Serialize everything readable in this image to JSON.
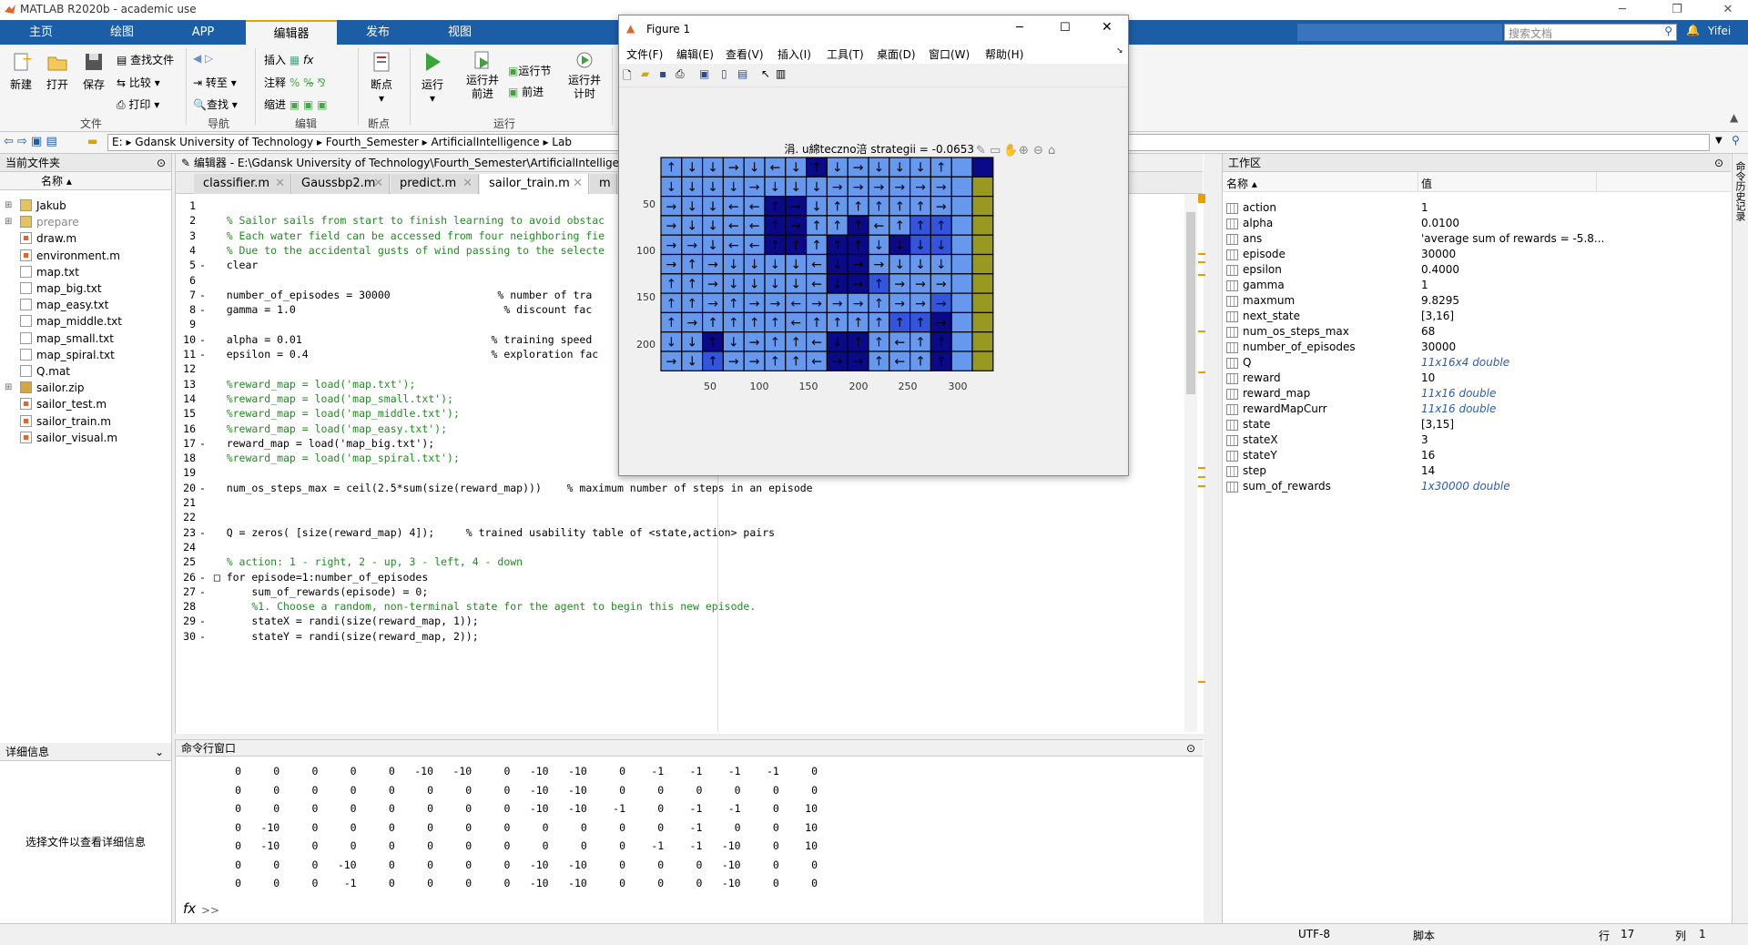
{
  "app": {
    "title": "MATLAB R2020b - academic use"
  },
  "tabs": [
    "主页",
    "绘图",
    "APP",
    "编辑器",
    "发布",
    "视图"
  ],
  "search": {
    "placeholder": "搜索文档"
  },
  "user": "Yifei",
  "ribbon": {
    "file": {
      "new": "新建",
      "open": "打开",
      "save": "保存",
      "find_files": "查找文件",
      "compare": "比较",
      "print": "打印",
      "group": "文件"
    },
    "nav": {
      "goto": "转至",
      "find": "查找",
      "group": "导航"
    },
    "edit": {
      "insert": "插入",
      "comment": "注释",
      "indent": "缩进",
      "fx": "fx",
      "group": "编辑"
    },
    "bp": {
      "breakpoints": "断点",
      "group": "断点"
    },
    "run": {
      "run": "运行",
      "run_advance": "运行并\n前进",
      "run_section": "运行节",
      "advance": "前进",
      "run_time": "运行并\n计时",
      "group": "运行"
    }
  },
  "address": [
    "E:",
    "Gdansk University of Technology",
    "Fourth_Semester",
    "ArtificialIntelligence",
    "Lab"
  ],
  "current_folder": {
    "title": "当前文件夹",
    "col": "名称 ▴",
    "files": [
      {
        "name": "Jakub",
        "type": "folder",
        "exp": true
      },
      {
        "name": "prepare",
        "type": "folder",
        "exp": true,
        "gray": true
      },
      {
        "name": "draw.m",
        "type": "m"
      },
      {
        "name": "environment.m",
        "type": "m"
      },
      {
        "name": "map.txt",
        "type": "txt"
      },
      {
        "name": "map_big.txt",
        "type": "txt"
      },
      {
        "name": "map_easy.txt",
        "type": "txt"
      },
      {
        "name": "map_middle.txt",
        "type": "txt"
      },
      {
        "name": "map_small.txt",
        "type": "txt"
      },
      {
        "name": "map_spiral.txt",
        "type": "txt"
      },
      {
        "name": "Q.mat",
        "type": "mat"
      },
      {
        "name": "sailor.zip",
        "type": "zip",
        "exp": true
      },
      {
        "name": "sailor_test.m",
        "type": "m"
      },
      {
        "name": "sailor_train.m",
        "type": "m"
      },
      {
        "name": "sailor_visual.m",
        "type": "m"
      }
    ]
  },
  "details": {
    "title": "详细信息",
    "msg": "选择文件以查看详细信息"
  },
  "editor": {
    "title": "编辑器 - E:\\Gdansk University of Technology\\Fourth_Semester\\ArtificialIntelligen",
    "tabs": [
      "classifier.m",
      "Gaussbp2.m",
      "predict.m",
      "sailor_train.m",
      "m"
    ],
    "lines": [
      {
        "n": "1",
        "t": ""
      },
      {
        "n": "2",
        "t": "    % Sailor sails from start to finish learning to avoid obstac",
        "c": 1
      },
      {
        "n": "3",
        "t": "    % Each water field can be accessed from four neighboring fie",
        "c": 1
      },
      {
        "n": "4",
        "t": "    % Due to the accidental gusts of wind passing to the selecte",
        "c": 1
      },
      {
        "n": "5",
        "t": "    clear",
        "d": 1
      },
      {
        "n": "6",
        "t": ""
      },
      {
        "n": "7",
        "t": "    number_of_episodes = 30000                 % number of tra",
        "d": 1
      },
      {
        "n": "8",
        "t": "    gamma = 1.0                                 % discount fac",
        "d": 1
      },
      {
        "n": "9",
        "t": ""
      },
      {
        "n": "10",
        "t": "    alpha = 0.01                              % training speed",
        "d": 1
      },
      {
        "n": "11",
        "t": "    epsilon = 0.4                             % exploration fac",
        "d": 1
      },
      {
        "n": "12",
        "t": ""
      },
      {
        "n": "13",
        "t": "    %reward_map = load('map.txt');",
        "c": 1
      },
      {
        "n": "14",
        "t": "    %reward_map = load('map_small.txt');",
        "c": 1
      },
      {
        "n": "15",
        "t": "    %reward_map = load('map_middle.txt');",
        "c": 1
      },
      {
        "n": "16",
        "t": "    %reward_map = load('map_easy.txt');",
        "c": 1
      },
      {
        "n": "17",
        "t": "    reward_map = load('map_big.txt');",
        "d": 1
      },
      {
        "n": "18",
        "t": "    %reward_map = load('map_spiral.txt');",
        "c": 1
      },
      {
        "n": "19",
        "t": ""
      },
      {
        "n": "20",
        "t": "    num_os_steps_max = ceil(2.5*sum(size(reward_map)))    % maximum number of steps in an episode",
        "d": 1
      },
      {
        "n": "21",
        "t": ""
      },
      {
        "n": "22",
        "t": ""
      },
      {
        "n": "23",
        "t": "    Q = zeros( [size(reward_map) 4]);     % trained usability table of <state,action> pairs",
        "d": 1
      },
      {
        "n": "24",
        "t": ""
      },
      {
        "n": "25",
        "t": "    % action: 1 - right, 2 - up, 3 - left, 4 - down",
        "c": 1
      },
      {
        "n": "26",
        "t": "  □ for episode=1:number_of_episodes",
        "d": 1
      },
      {
        "n": "27",
        "t": "        sum_of_rewards(episode) = 0;",
        "d": 1
      },
      {
        "n": "28",
        "t": "        %1. Choose a random, non-terminal state for the agent to begin this new episode.",
        "c": 1
      },
      {
        "n": "29",
        "t": "        stateX = randi(size(reward_map, 1));",
        "d": 1
      },
      {
        "n": "30",
        "t": "        stateY = randi(size(reward_map, 2));",
        "d": 1
      }
    ]
  },
  "cmd": {
    "title": "命令行窗口",
    "prompt": ">>",
    "rows": [
      [
        0,
        0,
        0,
        0,
        0,
        -10,
        -10,
        0,
        -10,
        -10,
        0,
        -1,
        -1,
        -1,
        -1,
        0
      ],
      [
        0,
        0,
        0,
        0,
        0,
        0,
        0,
        0,
        -10,
        -10,
        0,
        0,
        0,
        0,
        0,
        0
      ],
      [
        0,
        0,
        0,
        0,
        0,
        0,
        0,
        0,
        -10,
        -10,
        -1,
        0,
        -1,
        -1,
        0,
        10
      ],
      [
        0,
        -10,
        0,
        0,
        0,
        0,
        0,
        0,
        0,
        0,
        0,
        0,
        -1,
        0,
        0,
        10
      ],
      [
        0,
        -10,
        0,
        0,
        0,
        0,
        0,
        0,
        0,
        0,
        0,
        -1,
        -1,
        -10,
        0,
        10
      ],
      [
        0,
        0,
        0,
        -10,
        0,
        0,
        0,
        0,
        -10,
        -10,
        0,
        0,
        0,
        -10,
        0,
        0
      ],
      [
        0,
        0,
        0,
        -1,
        0,
        0,
        0,
        0,
        -10,
        -10,
        0,
        0,
        0,
        -10,
        0,
        0
      ]
    ]
  },
  "workspace": {
    "title": "工作区",
    "col_name": "名称 ▴",
    "col_value": "值",
    "vars": [
      {
        "name": "action",
        "value": "1"
      },
      {
        "name": "alpha",
        "value": "0.0100"
      },
      {
        "name": "ans",
        "value": "'average sum of rewards = -5.8..."
      },
      {
        "name": "episode",
        "value": "30000"
      },
      {
        "name": "epsilon",
        "value": "0.4000"
      },
      {
        "name": "gamma",
        "value": "1"
      },
      {
        "name": "maxmum",
        "value": "9.8295"
      },
      {
        "name": "next_state",
        "value": "[3,16]"
      },
      {
        "name": "num_os_steps_max",
        "value": "68"
      },
      {
        "name": "number_of_episodes",
        "value": "30000"
      },
      {
        "name": "Q",
        "value": "11x16x4 double",
        "it": 1
      },
      {
        "name": "reward",
        "value": "10"
      },
      {
        "name": "reward_map",
        "value": "11x16 double",
        "it": 1
      },
      {
        "name": "rewardMapCurr",
        "value": "11x16 double",
        "it": 1
      },
      {
        "name": "state",
        "value": "[3,15]"
      },
      {
        "name": "stateX",
        "value": "3"
      },
      {
        "name": "stateY",
        "value": "16"
      },
      {
        "name": "step",
        "value": "14"
      },
      {
        "name": "sum_of_rewards",
        "value": "1x30000 double",
        "it": 1
      }
    ]
  },
  "side_label": "命令历史记录",
  "status": {
    "encoding": "UTF-8",
    "type": "脚本",
    "row_label": "行",
    "row": "17",
    "col_label": "列",
    "col": "1"
  },
  "figure": {
    "title": "Figure 1",
    "menu": [
      "文件(F)",
      "编辑(E)",
      "查看(V)",
      "插入(I)",
      "工具(T)",
      "桌面(D)",
      "窗口(W)",
      "帮助(H)"
    ],
    "plot_title": "涓. u綿teczno涪 strategii = -0.0653",
    "xticks": [
      "50",
      "100",
      "150",
      "200",
      "250",
      "300"
    ],
    "yticks": [
      "50",
      "100",
      "150",
      "200"
    ],
    "colors": {
      "1": "#6699ee",
      "2": "#3355dd",
      "3": "#0a0a88",
      "4": "#999922"
    },
    "grid": [
      "1111111311111113",
      "1111111111111114",
      "1111133111111114",
      "1111133113112214",
      "1111133133132214",
      "1111111133111114",
      "1111111133211114",
      "1111111111111214",
      "1111111111122314",
      "1131111133111314",
      "1121111133111314"
    ],
    "arrows": [
      "↑↓↓→↓←↓↑↓→↓↓↓↑",
      "↓↓↓↓→↓↓↓→→→→→→",
      "→↓↓←←↑→↓↑↑↑↑↑→",
      "→↓↓←←↑→↑↑↑←↑↑↑",
      "→→↓←←↑↑↑↑↑↓↓↓↓",
      "→↑→↓↓↓↓←↓→→↓↓↓",
      "↑↑→↓↓↓↓←↓→↑→→→",
      "↑↑→↑→→←→→→↑→→→",
      "↑→↑↑↑↑←↑↑↑↑↑↑→",
      "↓↓↑↓→↑↑←↓↑↑←↑↑",
      "→↓↑→→↑↑←→→↑←↑↑"
    ]
  }
}
